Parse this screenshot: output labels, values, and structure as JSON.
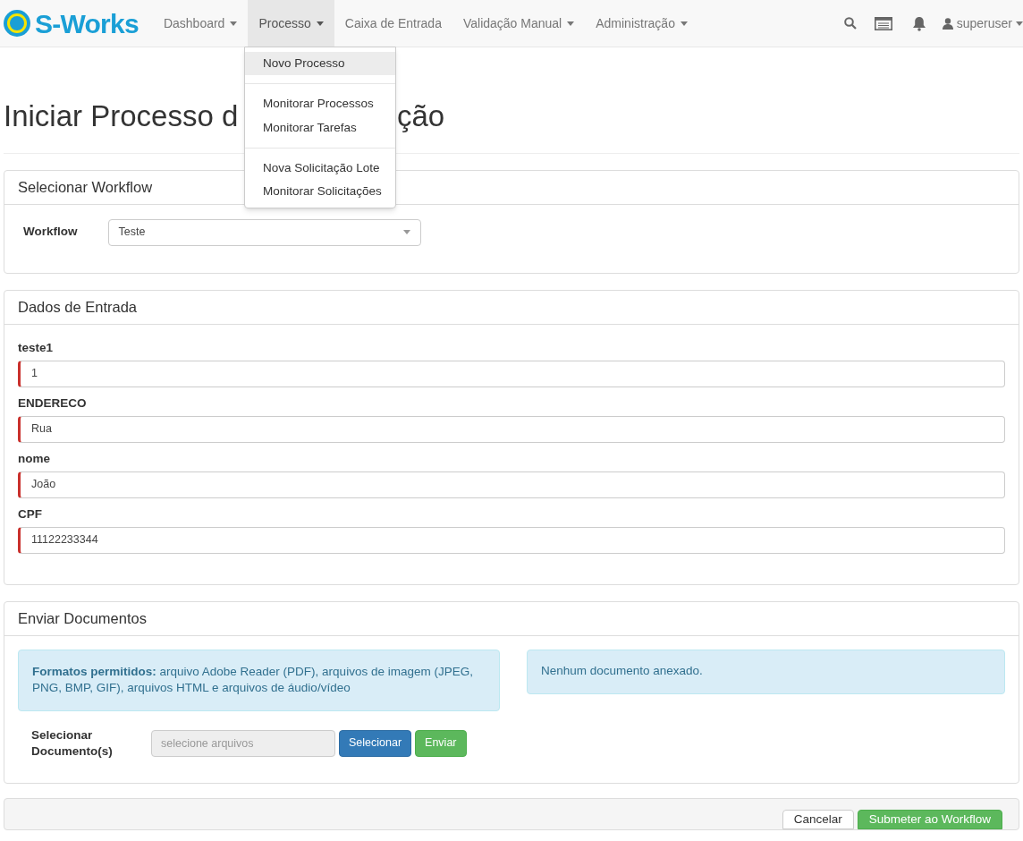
{
  "navbar": {
    "brand": "S-Works",
    "items": [
      {
        "label": "Dashboard",
        "dropdown": true,
        "selected": false
      },
      {
        "label": "Processo",
        "dropdown": true,
        "selected": true
      },
      {
        "label": "Caixa de Entrada",
        "dropdown": false,
        "selected": false
      },
      {
        "label": "Validação Manual",
        "dropdown": true,
        "selected": false
      },
      {
        "label": "Administração",
        "dropdown": true,
        "selected": false
      }
    ],
    "user": "superuser"
  },
  "dropdown_menu": {
    "groups": [
      [
        {
          "label": "Novo Processo",
          "selected": true
        }
      ],
      [
        {
          "label": "Monitorar Processos",
          "selected": false
        },
        {
          "label": "Monitorar Tarefas",
          "selected": false
        }
      ],
      [
        {
          "label": "Nova Solicitação Lote",
          "selected": false
        },
        {
          "label": "Monitorar Solicitações",
          "selected": false
        }
      ]
    ]
  },
  "page_title_parts": [
    "Iniciar Processo d",
    "ção"
  ],
  "workflow_panel": {
    "title": "Selecionar Workflow",
    "label": "Workflow",
    "value": "Teste"
  },
  "input_panel": {
    "title": "Dados de Entrada",
    "fields": [
      {
        "label": "teste1",
        "value": "1",
        "required": true
      },
      {
        "label": "ENDERECO",
        "value": "Rua",
        "required": true
      },
      {
        "label": "nome",
        "value": "João",
        "required": true
      },
      {
        "label": "CPF",
        "value": "11122233344",
        "required": true
      }
    ]
  },
  "documents_panel": {
    "title": "Enviar Documentos",
    "formats_notice": "**Formatos permitidos:** arquivo Adobe Reader (PDF), arquivos de imagem (JPEG, PNG, BMP, GIF), arquivos HTML e arquivos de áudio/vídeo",
    "attached_notice": "Nenhum documento anexado.",
    "select_label": "Selecionar Documento(s)",
    "file_placeholder": "selecione arquivos",
    "buttons": [
      "Selecionar",
      "Enviar"
    ]
  },
  "footer_buttons": [
    {
      "label": "Cancelar",
      "kind": "default"
    },
    {
      "label": "Submeter ao Workflow",
      "kind": "success"
    }
  ]
}
